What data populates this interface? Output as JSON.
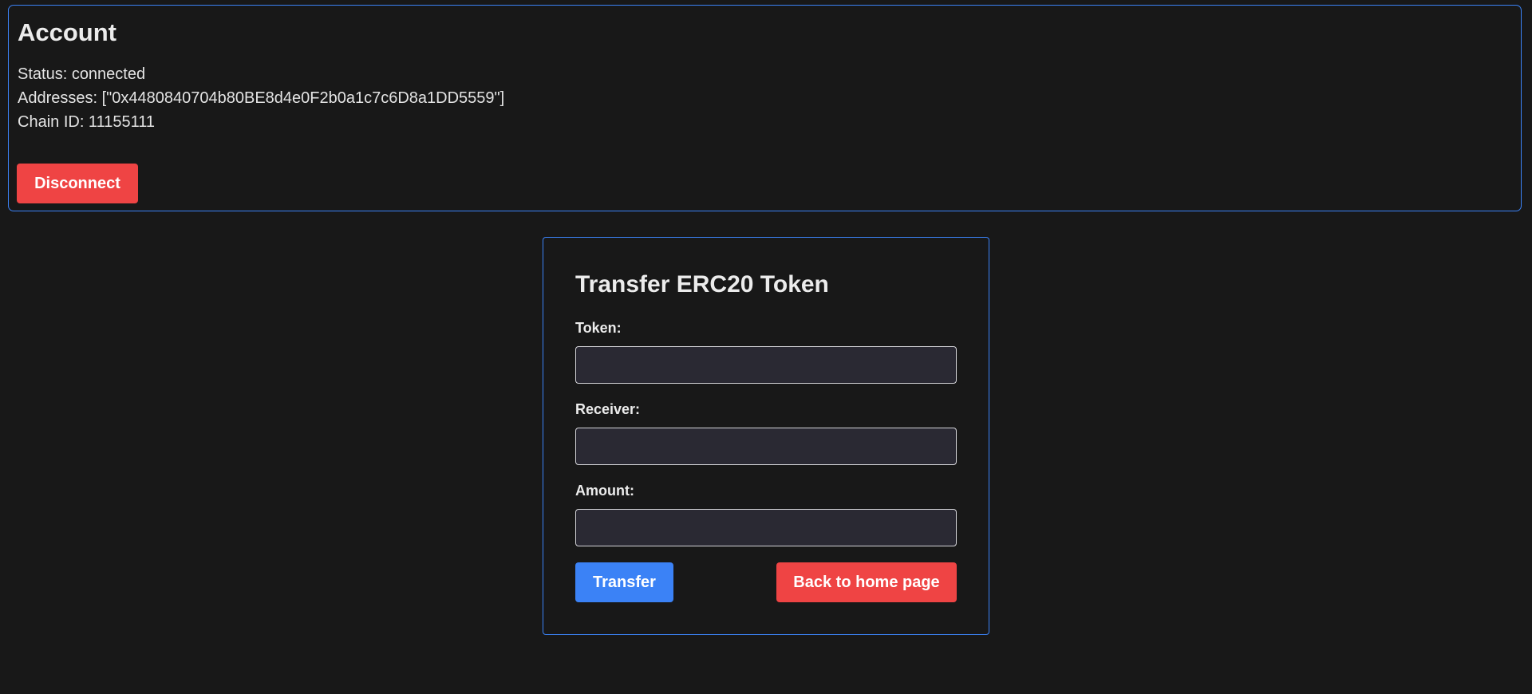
{
  "account": {
    "title": "Account",
    "status_line": "Status: connected",
    "addresses_line": "Addresses: [\"0x4480840704b80BE8d4e0F2b0a1c7c6D8a1DD5559\"]",
    "chain_line": "Chain ID: 11155111",
    "disconnect_label": "Disconnect"
  },
  "transfer": {
    "title": "Transfer ERC20 Token",
    "fields": [
      {
        "label": "Token:",
        "value": ""
      },
      {
        "label": "Receiver:",
        "value": ""
      },
      {
        "label": "Amount:",
        "value": ""
      }
    ],
    "transfer_label": "Transfer",
    "back_label": "Back to home page"
  },
  "colors": {
    "background": "#181818",
    "border_accent": "#3b82f6",
    "danger": "#ef4444",
    "primary": "#3b82f6",
    "input_bg": "#2a2933"
  }
}
